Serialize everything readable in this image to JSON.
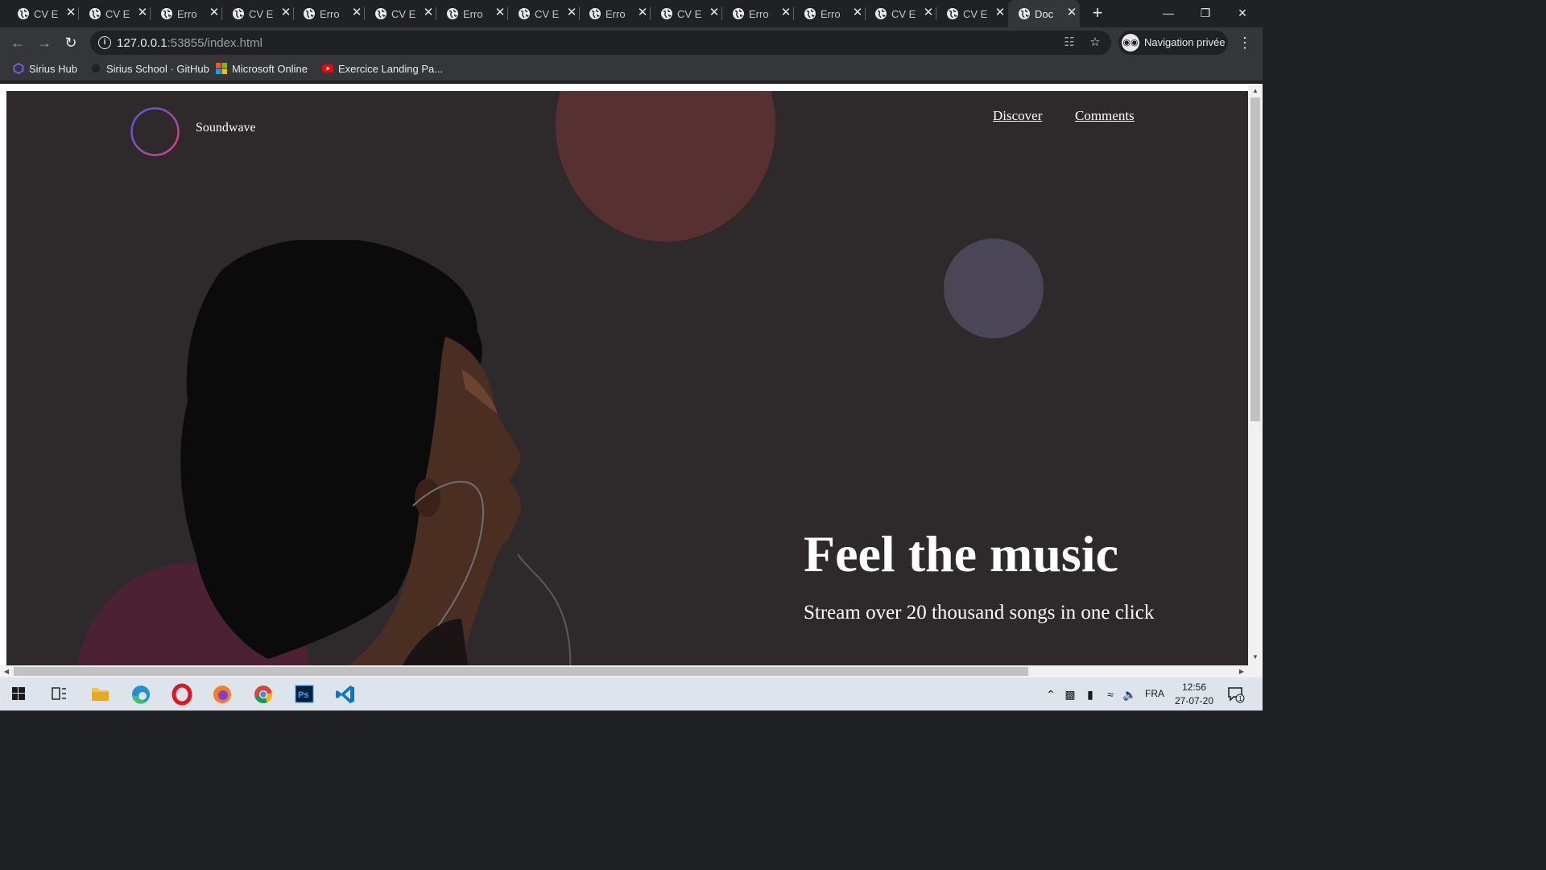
{
  "browser": {
    "tabs": [
      {
        "title": "CV E",
        "active": false
      },
      {
        "title": "CV E",
        "active": false
      },
      {
        "title": "Erro",
        "active": false
      },
      {
        "title": "CV E",
        "active": false
      },
      {
        "title": "Erro",
        "active": false
      },
      {
        "title": "CV E",
        "active": false
      },
      {
        "title": "Erro",
        "active": false
      },
      {
        "title": "CV E",
        "active": false
      },
      {
        "title": "Erro",
        "active": false
      },
      {
        "title": "CV E",
        "active": false
      },
      {
        "title": "Erro",
        "active": false
      },
      {
        "title": "Erro",
        "active": false
      },
      {
        "title": "CV E",
        "active": false
      },
      {
        "title": "CV E",
        "active": false
      },
      {
        "title": "Doc",
        "active": true
      }
    ],
    "url_host": "127.0.0.1",
    "url_rest": ":53855/index.html",
    "incognito_label": "Navigation privée",
    "bookmarks": [
      {
        "label": "Sirius Hub",
        "icon": "hexagon-icon"
      },
      {
        "label": "Sirius School · GitHub",
        "icon": "github-icon"
      },
      {
        "label": "Microsoft Online",
        "icon": "microsoft-icon"
      },
      {
        "label": "Exercice Landing Pa...",
        "icon": "youtube-icon"
      }
    ]
  },
  "site": {
    "brand": "Soundwave",
    "nav": [
      "Discover",
      "Comments"
    ],
    "hero_title": "Feel the music",
    "hero_subtitle": "Stream over 20 thousand songs in one click",
    "colors": {
      "background": "#2e292a",
      "circle_red": "#573032",
      "circle_slate": "#4a4657",
      "circle_wine": "#4b2133"
    }
  },
  "taskbar": {
    "apps": [
      "windows-start-icon",
      "task-view-icon",
      "file-explorer-icon",
      "edge-icon",
      "opera-icon",
      "firefox-icon",
      "chrome-icon",
      "photoshop-icon",
      "vscode-icon"
    ],
    "language": "FRA",
    "time": "12:56",
    "date": "27-07-20",
    "notification_count": "1"
  }
}
